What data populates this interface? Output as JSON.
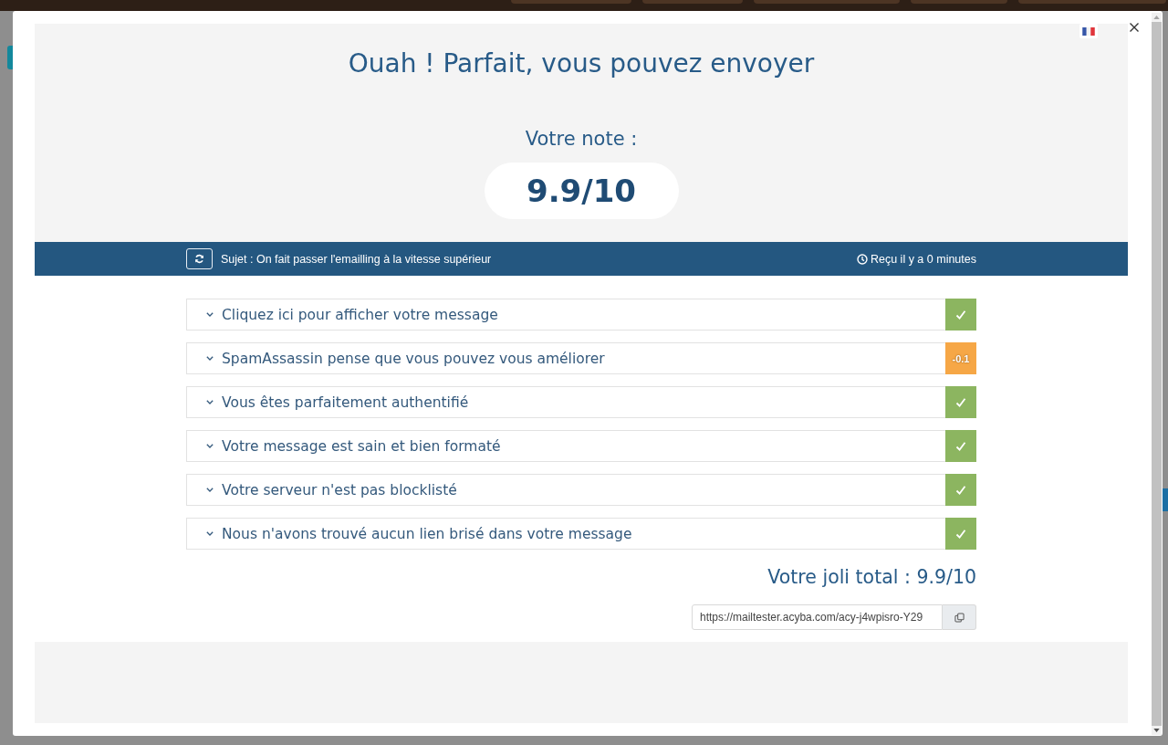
{
  "modal": {
    "title": "Ouah ! Parfait, vous pouvez envoyer",
    "score_label": "Votre note :",
    "score": "9.9/10",
    "message_bar": {
      "subject": "Sujet : On fait passer l'emailling à la vitesse supérieur",
      "received": "Reçu il y a 0 minutes"
    },
    "checks": [
      {
        "label": "Cliquez ici pour afficher votre message",
        "expanded": false,
        "kind": "pass",
        "color": "#8cb560"
      },
      {
        "label": "SpamAssassin pense que vous pouvez vous améliorer",
        "expanded": false,
        "kind": "score",
        "badge": "-0.1",
        "color": "#f6a746"
      },
      {
        "label": "Vous êtes parfaitement authentifié",
        "expanded": false,
        "kind": "pass",
        "color": "#8cb560"
      },
      {
        "label": "Votre message est sain et bien formaté",
        "expanded": false,
        "kind": "pass",
        "color": "#8cb560"
      },
      {
        "label": "Votre serveur n'est pas blocklisté",
        "expanded": false,
        "kind": "pass",
        "color": "#8cb560"
      },
      {
        "label": "Nous n'avons trouvé aucun lien brisé dans votre message",
        "expanded": false,
        "kind": "pass",
        "color": "#8cb560"
      }
    ],
    "total": "Votre joli total : 9.9/10",
    "share_link": {
      "value": "https://mailtester.acyba.com/acy-j4wpisro-Y29"
    }
  }
}
